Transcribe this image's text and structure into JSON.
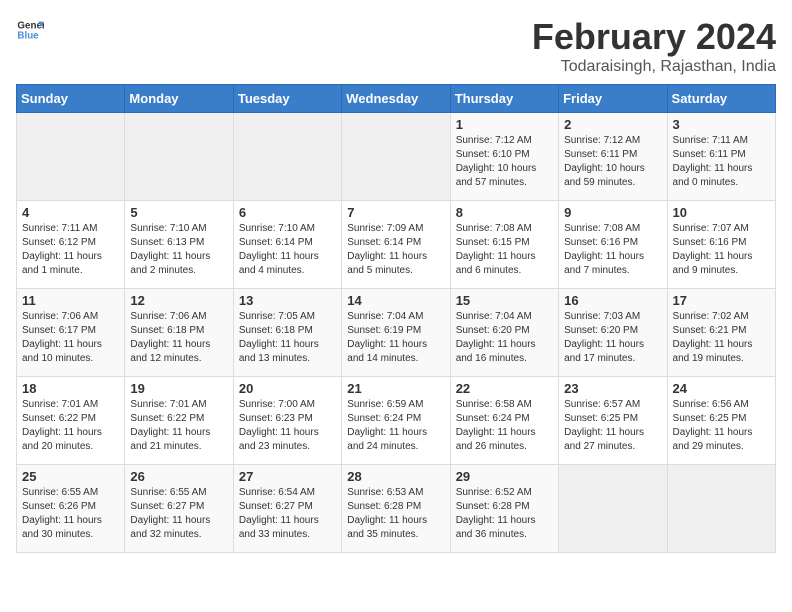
{
  "header": {
    "logo_general": "General",
    "logo_blue": "Blue",
    "month_year": "February 2024",
    "location": "Todaraisingh, Rajasthan, India"
  },
  "days_of_week": [
    "Sunday",
    "Monday",
    "Tuesday",
    "Wednesday",
    "Thursday",
    "Friday",
    "Saturday"
  ],
  "weeks": [
    [
      {
        "day": "",
        "info": ""
      },
      {
        "day": "",
        "info": ""
      },
      {
        "day": "",
        "info": ""
      },
      {
        "day": "",
        "info": ""
      },
      {
        "day": "1",
        "info": "Sunrise: 7:12 AM\nSunset: 6:10 PM\nDaylight: 10 hours and 57 minutes."
      },
      {
        "day": "2",
        "info": "Sunrise: 7:12 AM\nSunset: 6:11 PM\nDaylight: 10 hours and 59 minutes."
      },
      {
        "day": "3",
        "info": "Sunrise: 7:11 AM\nSunset: 6:11 PM\nDaylight: 11 hours and 0 minutes."
      }
    ],
    [
      {
        "day": "4",
        "info": "Sunrise: 7:11 AM\nSunset: 6:12 PM\nDaylight: 11 hours and 1 minute."
      },
      {
        "day": "5",
        "info": "Sunrise: 7:10 AM\nSunset: 6:13 PM\nDaylight: 11 hours and 2 minutes."
      },
      {
        "day": "6",
        "info": "Sunrise: 7:10 AM\nSunset: 6:14 PM\nDaylight: 11 hours and 4 minutes."
      },
      {
        "day": "7",
        "info": "Sunrise: 7:09 AM\nSunset: 6:14 PM\nDaylight: 11 hours and 5 minutes."
      },
      {
        "day": "8",
        "info": "Sunrise: 7:08 AM\nSunset: 6:15 PM\nDaylight: 11 hours and 6 minutes."
      },
      {
        "day": "9",
        "info": "Sunrise: 7:08 AM\nSunset: 6:16 PM\nDaylight: 11 hours and 7 minutes."
      },
      {
        "day": "10",
        "info": "Sunrise: 7:07 AM\nSunset: 6:16 PM\nDaylight: 11 hours and 9 minutes."
      }
    ],
    [
      {
        "day": "11",
        "info": "Sunrise: 7:06 AM\nSunset: 6:17 PM\nDaylight: 11 hours and 10 minutes."
      },
      {
        "day": "12",
        "info": "Sunrise: 7:06 AM\nSunset: 6:18 PM\nDaylight: 11 hours and 12 minutes."
      },
      {
        "day": "13",
        "info": "Sunrise: 7:05 AM\nSunset: 6:18 PM\nDaylight: 11 hours and 13 minutes."
      },
      {
        "day": "14",
        "info": "Sunrise: 7:04 AM\nSunset: 6:19 PM\nDaylight: 11 hours and 14 minutes."
      },
      {
        "day": "15",
        "info": "Sunrise: 7:04 AM\nSunset: 6:20 PM\nDaylight: 11 hours and 16 minutes."
      },
      {
        "day": "16",
        "info": "Sunrise: 7:03 AM\nSunset: 6:20 PM\nDaylight: 11 hours and 17 minutes."
      },
      {
        "day": "17",
        "info": "Sunrise: 7:02 AM\nSunset: 6:21 PM\nDaylight: 11 hours and 19 minutes."
      }
    ],
    [
      {
        "day": "18",
        "info": "Sunrise: 7:01 AM\nSunset: 6:22 PM\nDaylight: 11 hours and 20 minutes."
      },
      {
        "day": "19",
        "info": "Sunrise: 7:01 AM\nSunset: 6:22 PM\nDaylight: 11 hours and 21 minutes."
      },
      {
        "day": "20",
        "info": "Sunrise: 7:00 AM\nSunset: 6:23 PM\nDaylight: 11 hours and 23 minutes."
      },
      {
        "day": "21",
        "info": "Sunrise: 6:59 AM\nSunset: 6:24 PM\nDaylight: 11 hours and 24 minutes."
      },
      {
        "day": "22",
        "info": "Sunrise: 6:58 AM\nSunset: 6:24 PM\nDaylight: 11 hours and 26 minutes."
      },
      {
        "day": "23",
        "info": "Sunrise: 6:57 AM\nSunset: 6:25 PM\nDaylight: 11 hours and 27 minutes."
      },
      {
        "day": "24",
        "info": "Sunrise: 6:56 AM\nSunset: 6:25 PM\nDaylight: 11 hours and 29 minutes."
      }
    ],
    [
      {
        "day": "25",
        "info": "Sunrise: 6:55 AM\nSunset: 6:26 PM\nDaylight: 11 hours and 30 minutes."
      },
      {
        "day": "26",
        "info": "Sunrise: 6:55 AM\nSunset: 6:27 PM\nDaylight: 11 hours and 32 minutes."
      },
      {
        "day": "27",
        "info": "Sunrise: 6:54 AM\nSunset: 6:27 PM\nDaylight: 11 hours and 33 minutes."
      },
      {
        "day": "28",
        "info": "Sunrise: 6:53 AM\nSunset: 6:28 PM\nDaylight: 11 hours and 35 minutes."
      },
      {
        "day": "29",
        "info": "Sunrise: 6:52 AM\nSunset: 6:28 PM\nDaylight: 11 hours and 36 minutes."
      },
      {
        "day": "",
        "info": ""
      },
      {
        "day": "",
        "info": ""
      }
    ]
  ]
}
